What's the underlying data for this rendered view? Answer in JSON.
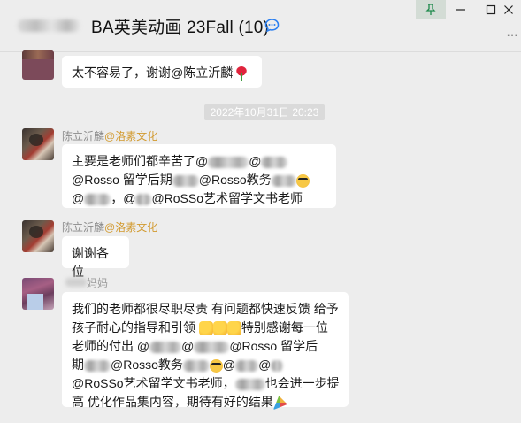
{
  "window": {
    "title": "BA英美动画 23Fall (10)",
    "more_label": "···"
  },
  "messages": [
    {
      "id": "m1",
      "text": "太不容易了，谢谢@陈立沂麟"
    },
    {
      "id": "m2",
      "sender_name": "陈立沂麟",
      "sender_tag": "@洛素文化",
      "line1_a": "主要是老师们都辛苦了@",
      "line1_b": "@",
      "line2_a": "@Rosso 留学后期",
      "line2_b": "@Rosso教务",
      "line3_a": "@",
      "line3_b": "，@",
      "line3_c": "@RoSSo艺术留学文书老师"
    },
    {
      "id": "m3",
      "sender_name": "陈立沂麟",
      "sender_tag": "@洛素文化",
      "text": "谢谢各位"
    },
    {
      "id": "m4",
      "sender_name": "妈妈",
      "line1": "我们的老师都很尽职尽责 有问题都快速反馈 给予",
      "line2_a": "孩子耐心的指导和引领",
      "line2_b": "特别感谢每一位",
      "line3_a": "老师的付出 @",
      "line3_b": "@",
      "line3_c": "@Rosso 留学后",
      "line4_a": "期",
      "line4_b": "@Rosso教务",
      "line4_c": "@",
      "line4_d": "@",
      "line5_a": "@RoSSo艺术留学文书老师，",
      "line5_b": "也会进一步提",
      "line6": "高 优化作品集内容，期待有好的结果"
    }
  ],
  "timestamp": "2022年10月31日 20:23",
  "colors": {
    "background": "#ededed",
    "bubble": "#ffffff",
    "sender_tag": "#d29a2f",
    "timestamp_bg": "#dadada"
  },
  "icons": [
    "chat-bubble-icon",
    "pin-icon",
    "minimize-icon",
    "maximize-icon",
    "close-icon",
    "more-icon",
    "rose-emoji",
    "grin-emoji",
    "thumbs-up-emoji",
    "party-popper-emoji"
  ]
}
